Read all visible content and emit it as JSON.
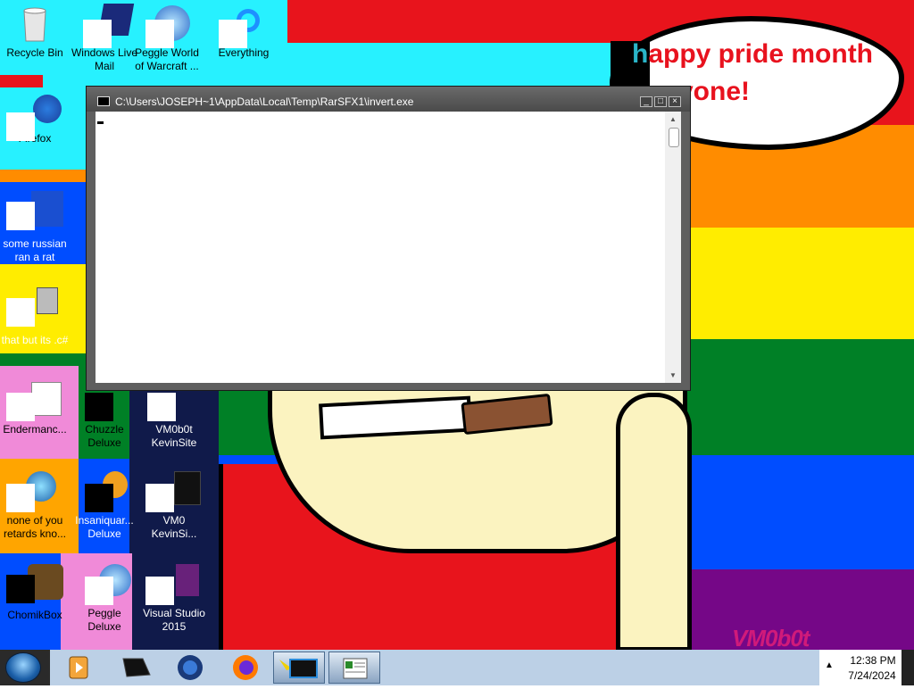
{
  "desktop": {
    "speech_bubble": {
      "line1_first": "h",
      "line1_rest": "appy pride month",
      "line2": "vone!"
    },
    "signature": "VM0b0t",
    "icons": [
      {
        "id": "recycle-bin",
        "label": "Recycle Bin"
      },
      {
        "id": "windows-live-mail",
        "label": "Windows Live Mail"
      },
      {
        "id": "peggle-world-of-warcraft",
        "label": "Peggle World of Warcraft ..."
      },
      {
        "id": "everything",
        "label": "Everything"
      },
      {
        "id": "firefox",
        "label": "Firefox"
      },
      {
        "id": "some-russian-ran-a-rat",
        "label": "some russian ran a rat"
      },
      {
        "id": "that-but-its",
        "label": "that but its .c#"
      },
      {
        "id": "endermanc",
        "label": "Endermanc..."
      },
      {
        "id": "chuzzle-deluxe",
        "label": "Chuzzle Deluxe"
      },
      {
        "id": "vm0b0t-kevinsite",
        "label": "VM0b0t KevinSite"
      },
      {
        "id": "none-of-you-retards",
        "label": "none of you retards kno..."
      },
      {
        "id": "insaniquarium-deluxe",
        "label": "Insaniquar... Deluxe"
      },
      {
        "id": "vm0-kevinsi",
        "label": "VM0 KevinSi..."
      },
      {
        "id": "chomikbox",
        "label": "ChomikBox"
      },
      {
        "id": "peggle-deluxe",
        "label": "Peggle Deluxe"
      },
      {
        "id": "visual-studio-2015",
        "label": "Visual Studio 2015"
      }
    ]
  },
  "console_window": {
    "title": "C:\\Users\\JOSEPH~1\\AppData\\Local\\Temp\\RarSFX1\\invert.exe",
    "controls": {
      "minimize": "_",
      "maximize": "□",
      "close": "×"
    }
  },
  "taskbar": {
    "pinned": [
      "windows-media-player-icon",
      "unknown-app-icon",
      "peggle-icon",
      "firefox-icon",
      "command-prompt-icon",
      "notepad-window-icon"
    ],
    "tray_arrow": "▲",
    "clock": {
      "time": "12:38 PM",
      "date": "7/24/2024"
    }
  }
}
